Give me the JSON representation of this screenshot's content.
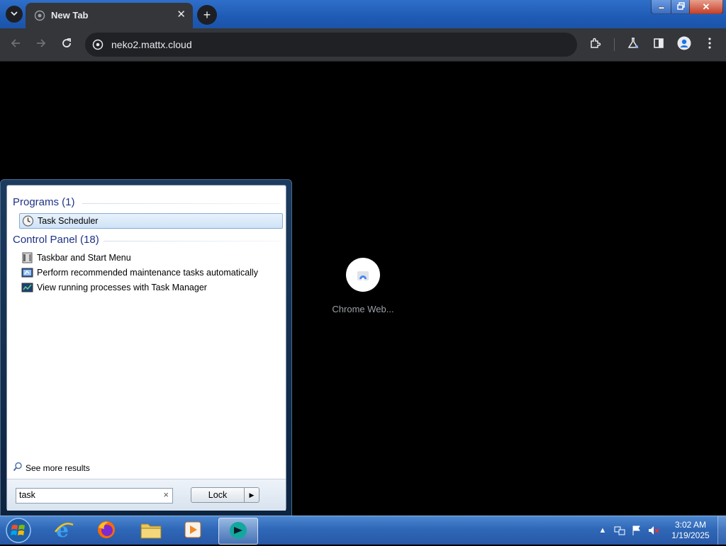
{
  "browser": {
    "tab": {
      "title": "New Tab"
    },
    "address_bar": {
      "url": "neko2.mattx.cloud"
    },
    "icons": {
      "tab_search": "chevron-down-icon",
      "new_tab": "plus-icon",
      "tab_close": "close-icon",
      "back": "arrow-left-icon",
      "forward": "arrow-right-icon",
      "reload": "reload-icon",
      "site_info": "site-info-icon",
      "extensions": "puzzle-icon",
      "labs": "flask-icon",
      "side_panel": "side-panel-icon",
      "profile": "profile-icon",
      "menu": "kebab-menu-icon"
    },
    "new_tab_page": {
      "shortcut_label": "Chrome Web..."
    }
  },
  "start_menu": {
    "programs": {
      "heading": "Programs (1)",
      "items": [
        {
          "label": "Task Scheduler",
          "icon": "clock-icon",
          "selected": true
        }
      ]
    },
    "control_panel": {
      "heading": "Control Panel (18)",
      "items": [
        {
          "label": "Taskbar and Start Menu",
          "icon": "taskbar-icon"
        },
        {
          "label": "Perform recommended maintenance tasks automatically",
          "icon": "action-center-icon"
        },
        {
          "label": "View running processes with Task Manager",
          "icon": "task-manager-icon"
        }
      ]
    },
    "see_more": "See more results",
    "search": {
      "value": "task",
      "clear": "×"
    },
    "lock_button": "Lock",
    "lock_arrow": "▶"
  },
  "taskbar": {
    "apps": [
      {
        "name": "Internet Explorer",
        "icon": "ie-icon"
      },
      {
        "name": "Firefox",
        "icon": "firefox-icon"
      },
      {
        "name": "Windows Explorer",
        "icon": "folder-icon"
      },
      {
        "name": "Media Player",
        "icon": "media-player-icon"
      },
      {
        "name": "Neko",
        "icon": "neko-icon",
        "active": true
      }
    ],
    "clock": {
      "time": "3:02 AM",
      "date": "1/19/2025"
    }
  },
  "colors": {
    "chrome_frame": "#1f5bb5",
    "chrome_toolbar": "#35363a",
    "start_menu_heading": "#1e3287",
    "taskbar": "#2f68b8"
  }
}
